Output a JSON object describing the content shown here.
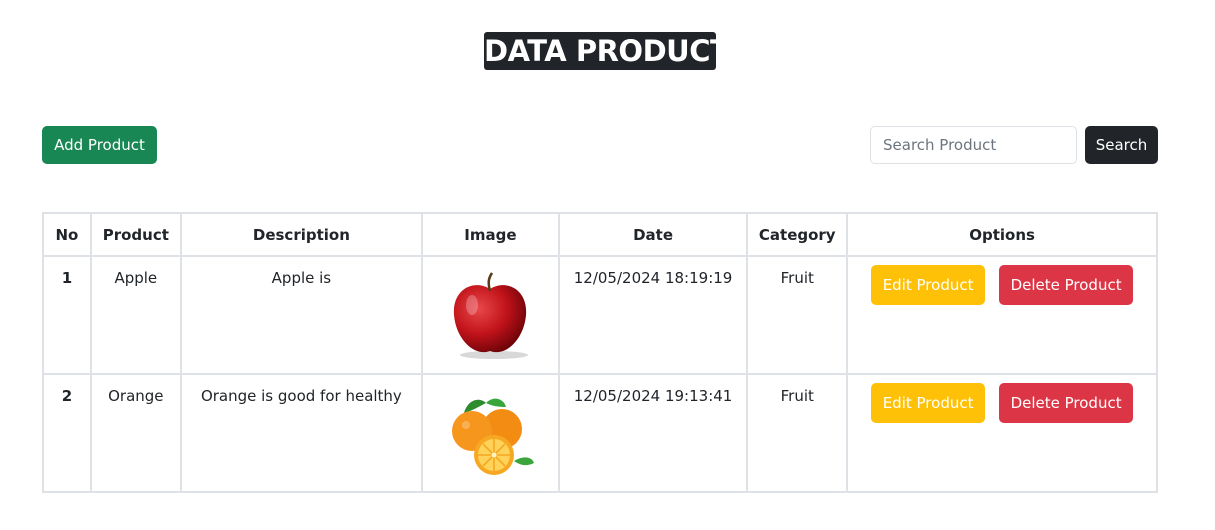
{
  "title": "DATA PRODUCT",
  "toolbar": {
    "add_label": "Add Product",
    "search_placeholder": "Search Product",
    "search_value": "",
    "search_label": "Search"
  },
  "table": {
    "headers": [
      "No",
      "Product",
      "Description",
      "Image",
      "Date",
      "Category",
      "Options"
    ],
    "rows": [
      {
        "no": "1",
        "product": "Apple",
        "description": "Apple is",
        "image": "apple-image",
        "date": "12/05/2024 18:19:19",
        "category": "Fruit",
        "edit_label": "Edit Product",
        "delete_label": "Delete Product"
      },
      {
        "no": "2",
        "product": "Orange",
        "description": "Orange is good for healthy",
        "image": "orange-image",
        "date": "12/05/2024 19:13:41",
        "category": "Fruit",
        "edit_label": "Edit Product",
        "delete_label": "Delete Product"
      }
    ]
  },
  "colors": {
    "title_bg": "#212529",
    "add_button": "#198754",
    "search_button": "#212529",
    "edit_button": "#ffc107",
    "delete_button": "#dc3545"
  }
}
